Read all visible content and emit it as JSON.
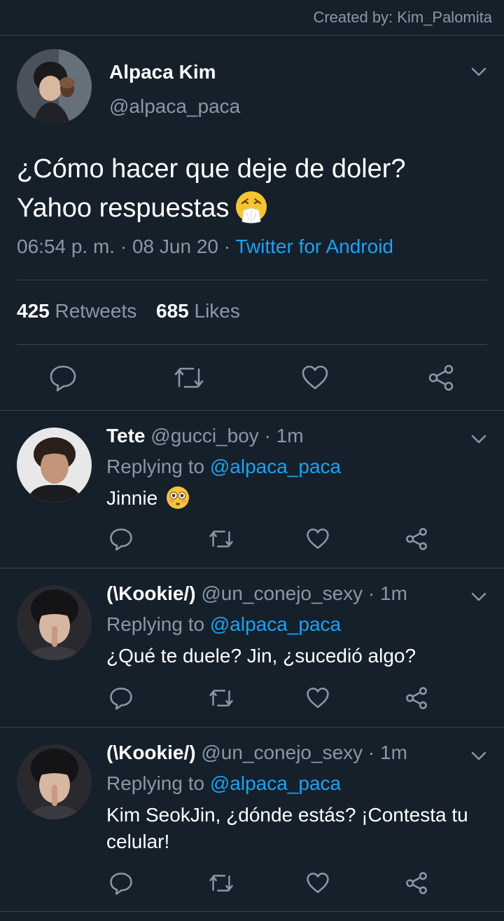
{
  "credit": "Created by: Kim_Palomita",
  "main_tweet": {
    "name": "Alpaca Kim",
    "handle": "@alpaca_paca",
    "text_line1": "¿Cómo hacer que deje de doler?",
    "text_line2": "Yahoo respuestas",
    "emoji": "sneezing-face-emoji",
    "time": "06:54 p. m. · 08 Jun 20 · ",
    "source": "Twitter for Android",
    "retweets_count": "425",
    "retweets_label": "Retweets",
    "likes_count": "685",
    "likes_label": "Likes"
  },
  "replies": [
    {
      "name": "Tete",
      "handle": "@gucci_boy · 1m",
      "replying_prefix": "Replying to ",
      "replying_to": "@alpaca_paca",
      "text": "Jinnie",
      "emoji": "flushed-face-emoji"
    },
    {
      "name": "(\\Kookie/)",
      "handle": "@un_conejo_sexy · 1m",
      "replying_prefix": "Replying to ",
      "replying_to": "@alpaca_paca",
      "text": "¿Qué te duele? Jin, ¿sucedió algo?"
    },
    {
      "name": "(\\Kookie/)",
      "handle": "@un_conejo_sexy · 1m",
      "replying_prefix": "Replying to ",
      "replying_to": "@alpaca_paca",
      "text": "Kim SeokJin, ¿dónde estás? ¡Contesta tu celular!"
    }
  ],
  "colors": {
    "background": "#15202b",
    "divider": "#38444d",
    "secondary_text": "#8899a6",
    "link": "#1da1f2"
  },
  "icons": [
    "chevron-down-icon",
    "reply-icon",
    "retweet-icon",
    "like-icon",
    "share-icon"
  ]
}
